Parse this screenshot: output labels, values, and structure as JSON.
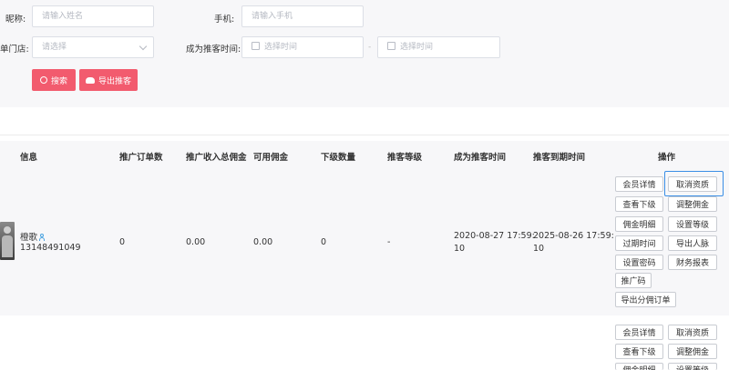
{
  "filters": {
    "nickname_label": "昵称:",
    "nickname_placeholder": "请输入姓名",
    "phone_label": "手机:",
    "phone_placeholder": "请输入手机",
    "store_label": "单门店:",
    "store_placeholder": "请选择",
    "promoter_time_label": "成为推客时间:",
    "start_placeholder": "选择时间",
    "range_separator": "-",
    "end_placeholder": "选择时间",
    "search_label": "搜索",
    "export_label": "导出推客"
  },
  "table": {
    "headers": {
      "info": "信息",
      "orders": "推广订单数",
      "income": "推广收入总佣金",
      "available": "可用佣金",
      "subordinates": "下级数量",
      "level": "推客等级",
      "became": "成为推客时间",
      "expires": "推客到期时间",
      "actions": "操作"
    },
    "rows": [
      {
        "name": "橙歌",
        "phone": "13148491049",
        "orders": "0",
        "income": "0.00",
        "available": "0.00",
        "subordinates": "0",
        "level": "-",
        "became_line1": "2020-08-27 17:59:",
        "became_line2": "10",
        "expires_line1": "2025-08-26 17:59:",
        "expires_line2": "10"
      }
    ],
    "actions": [
      "会员详情",
      "取消资质",
      "查看下级",
      "调整佣金",
      "佣金明细",
      "设置等级",
      "过期时间",
      "导出人脉",
      "设置密码",
      "财务报表",
      "推广码",
      "导出分佣订单"
    ],
    "row2_actions": [
      "会员详情",
      "取消资质",
      "查看下级",
      "调整佣金",
      "佣金明细",
      "设置等级"
    ]
  },
  "colors": {
    "accent_red": "#f25b6e",
    "focus_blue": "#3a8ee6",
    "header_bg": "#f7f7f9"
  }
}
